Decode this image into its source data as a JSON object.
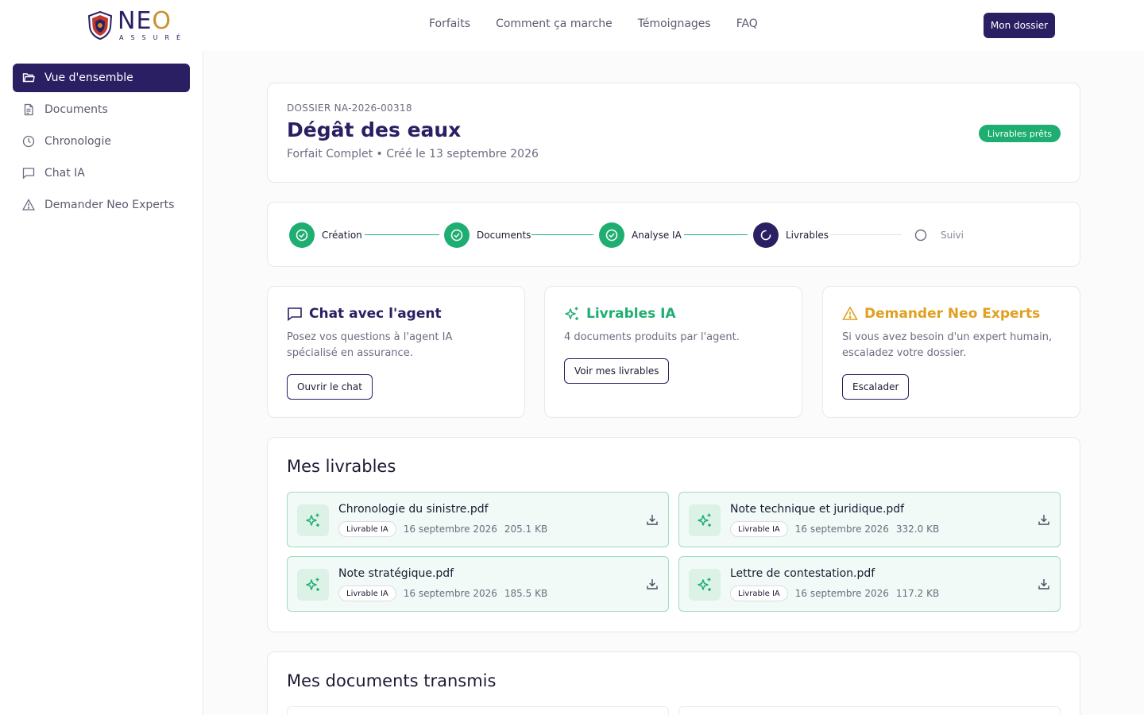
{
  "brand": {
    "word_start": "N",
    "word_e": "E",
    "word_o": "O",
    "sub": "ASSURÉ"
  },
  "nav": {
    "items": [
      "Forfaits",
      "Comment ça marche",
      "Témoignages",
      "FAQ"
    ],
    "cta": "Mon dossier"
  },
  "sidebar": {
    "items": [
      {
        "label": "Vue d'ensemble",
        "icon": "folder-icon",
        "active": true
      },
      {
        "label": "Documents",
        "icon": "document-icon"
      },
      {
        "label": "Chronologie",
        "icon": "clock-icon"
      },
      {
        "label": "Chat IA",
        "icon": "chat-icon"
      },
      {
        "label": "Demander Neo Experts",
        "icon": "warning-icon"
      }
    ]
  },
  "dossier": {
    "id": "DOSSIER NA-2026-00318",
    "title": "Dégât des eaux",
    "subtitle": "Forfait Complet • Créé le 13 septembre 2026",
    "badge": "Livrables prêts"
  },
  "steps": [
    {
      "label": "Création",
      "state": "done"
    },
    {
      "label": "Documents",
      "state": "done"
    },
    {
      "label": "Analyse IA",
      "state": "done"
    },
    {
      "label": "Livrables",
      "state": "current"
    },
    {
      "label": "Suivi",
      "state": "pending"
    }
  ],
  "actions": [
    {
      "title": "Chat avec l'agent",
      "desc": "Posez vos questions à l'agent IA spécialisé en assurance.",
      "button": "Ouvrir le chat",
      "icon": "chat-icon",
      "color": "#2a1f63"
    },
    {
      "title": "Livrables IA",
      "desc": "4 documents produits par l'agent.",
      "button": "Voir mes livrables",
      "icon": "sparkles-icon",
      "color": "#1fae72"
    },
    {
      "title": "Demander Neo Experts",
      "desc": "Si vous avez besoin d'un expert humain, escaladez votre dossier.",
      "button": "Escalader",
      "icon": "warning-icon",
      "color": "#e0a020"
    }
  ],
  "livrables": {
    "title": "Mes livrables",
    "files": [
      {
        "name": "Chronologie du sinistre.pdf",
        "tag": "Livrable IA",
        "date": "16 septembre 2026",
        "size": "205.1 KB"
      },
      {
        "name": "Note technique et juridique.pdf",
        "tag": "Livrable IA",
        "date": "16 septembre 2026",
        "size": "332.0 KB"
      },
      {
        "name": "Note stratégique.pdf",
        "tag": "Livrable IA",
        "date": "16 septembre 2026",
        "size": "185.5 KB"
      },
      {
        "name": "Lettre de contestation.pdf",
        "tag": "Livrable IA",
        "date": "16 septembre 2026",
        "size": "117.2 KB"
      }
    ]
  },
  "documents": {
    "title": "Mes documents transmis"
  },
  "colors": {
    "primary": "#2a1f63",
    "success": "#1fae72",
    "warning": "#e0a020",
    "gold": "#c9922e"
  }
}
